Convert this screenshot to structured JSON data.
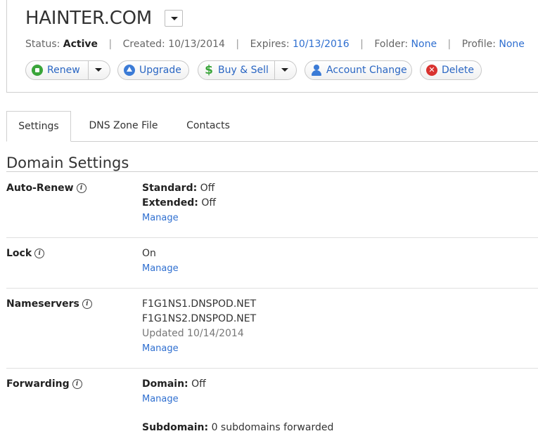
{
  "domain": {
    "name": "HAINTER.COM",
    "status_label": "Status:",
    "status_value": "Active",
    "created_label": "Created:",
    "created_value": "10/13/2014",
    "expires_label": "Expires:",
    "expires_value": "10/13/2016",
    "folder_label": "Folder:",
    "folder_value": "None",
    "profile_label": "Profile:",
    "profile_value": "None"
  },
  "actions": {
    "renew": "Renew",
    "upgrade": "Upgrade",
    "buy_sell": "Buy & Sell",
    "account_change": "Account Change",
    "delete": "Delete"
  },
  "tabs": [
    "Settings",
    "DNS Zone File",
    "Contacts"
  ],
  "section_title": "Domain Settings",
  "settings": {
    "auto_renew": {
      "label": "Auto-Renew",
      "standard_label": "Standard:",
      "standard_value": "Off",
      "extended_label": "Extended:",
      "extended_value": "Off",
      "manage": "Manage"
    },
    "lock": {
      "label": "Lock",
      "value": "On",
      "manage": "Manage"
    },
    "nameservers": {
      "label": "Nameservers",
      "ns1": "F1G1NS1.DNSPOD.NET",
      "ns2": "F1G1NS2.DNSPOD.NET",
      "updated": "Updated 10/14/2014",
      "manage": "Manage"
    },
    "forwarding": {
      "label": "Forwarding",
      "domain_label": "Domain:",
      "domain_value": "Off",
      "manage": "Manage",
      "subdomain_label": "Subdomain:",
      "subdomain_value": "0 subdomains forwarded"
    }
  },
  "colors": {
    "link": "#2f6fd0",
    "renew": "#3aa53a",
    "delete": "#d9322f"
  }
}
